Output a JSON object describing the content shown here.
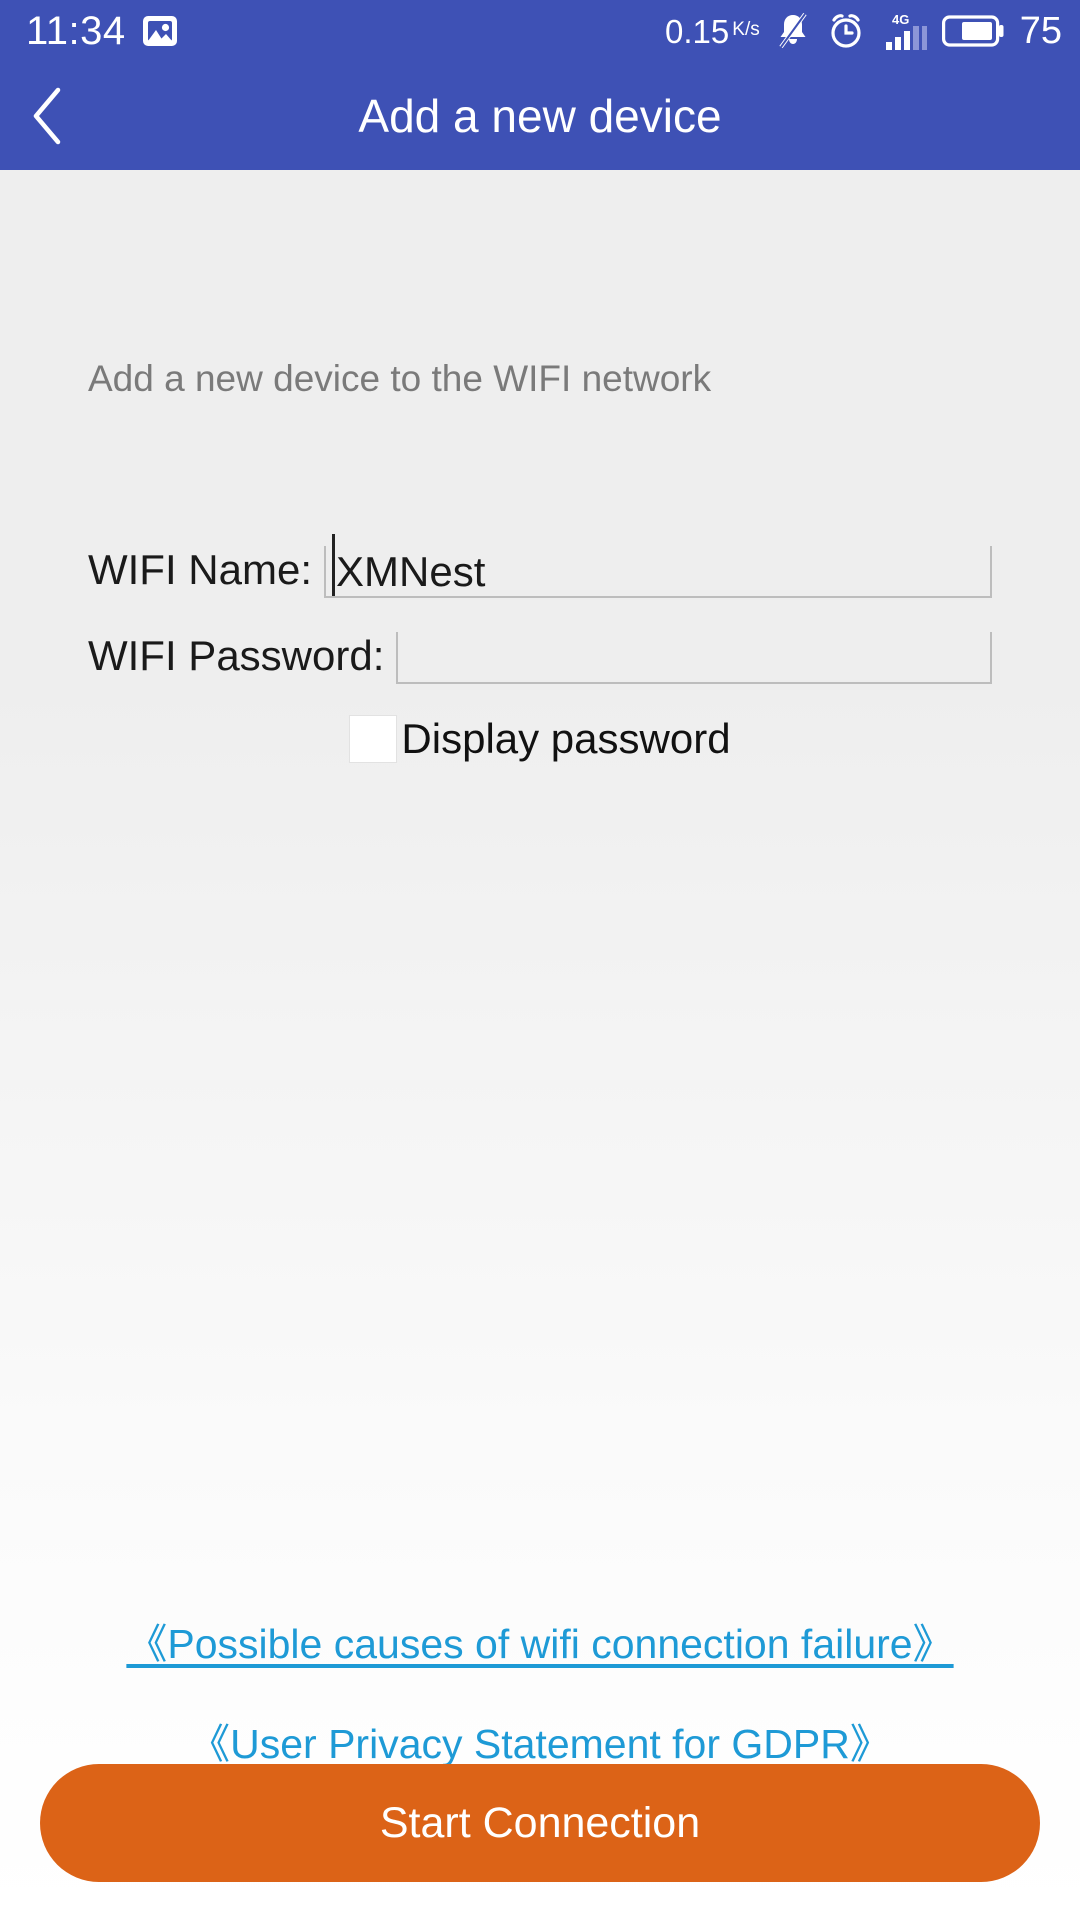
{
  "status_bar": {
    "time": "11:34",
    "screenshot_icon": "image-icon",
    "network_speed": "0.15",
    "network_speed_unit": "K/s",
    "mute_icon": "bell-muted-icon",
    "alarm_icon": "alarm-clock-icon",
    "signal_label": "4G",
    "signal_icon": "cellular-signal-icon",
    "battery_icon": "battery-icon",
    "battery_level": "75",
    "background_color": "#3e51b5",
    "foreground_color": "#ffffff"
  },
  "app_bar": {
    "back_icon": "back-chevron-icon",
    "title": "Add a new device",
    "background_color": "#3e51b5"
  },
  "main": {
    "subtitle": "Add a new device to the WIFI network",
    "wifi_name": {
      "label": "WIFI Name:",
      "value": "XMNest",
      "placeholder": ""
    },
    "wifi_password": {
      "label": "WIFI Password:",
      "value": "",
      "placeholder": ""
    },
    "display_password": {
      "label": "Display password",
      "checked": false
    }
  },
  "links": [
    {
      "text": "《Possible causes of wifi connection failure》"
    },
    {
      "text": "《User Privacy Statement for GDPR》"
    }
  ],
  "cta": {
    "label": "Start Connection",
    "color": "#dc6317"
  },
  "colors": {
    "primary": "#3e51b5",
    "accent": "#dc6317",
    "link": "#1e9ad6",
    "page_bg_top": "#eeeeee",
    "page_bg_bottom": "#ffffff"
  }
}
